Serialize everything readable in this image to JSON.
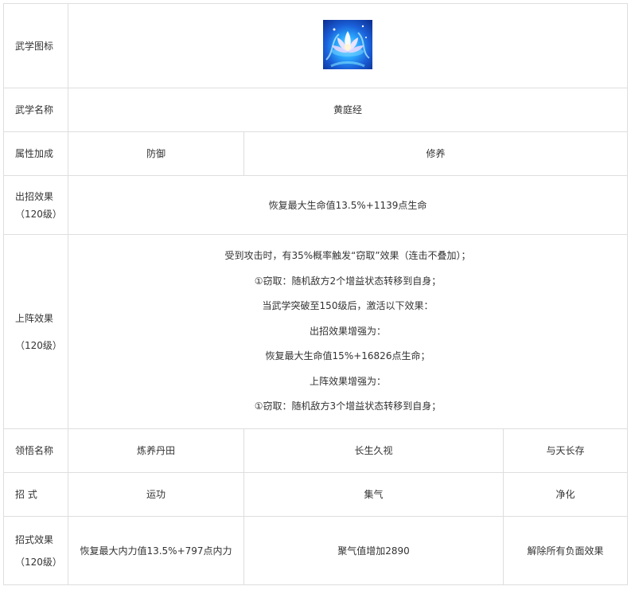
{
  "rows": {
    "icon": {
      "label": "武学图标",
      "icon_name": "lotus-skill-icon"
    },
    "name": {
      "label": "武学名称",
      "value": "黄庭经"
    },
    "attr": {
      "label": "属性加成",
      "values": [
        "防御",
        "修养"
      ]
    },
    "move_effect": {
      "label_lines": [
        "出招效果",
        "（120级）"
      ],
      "value": "恢复最大生命值13.5%+1139点生命"
    },
    "deploy_effect": {
      "label_lines": [
        "上阵效果",
        "（120级）"
      ],
      "lines": [
        "受到攻击时，有35%概率触发“窃取”效果（连击不叠加）；",
        "①窃取：随机敌方2个增益状态转移到自身；",
        "当武学突破至150级后，激活以下效果：",
        "出招效果增强为：",
        "恢复最大生命值15%+16826点生命；",
        "上阵效果增强为：",
        "①窃取：随机敌方3个增益状态转移到自身；"
      ]
    },
    "insight": {
      "label": "领悟名称",
      "values": [
        "炼养丹田",
        "长生久视",
        "与天长存"
      ]
    },
    "moves": {
      "label": "招 式",
      "values": [
        "运功",
        "集气",
        "净化"
      ]
    },
    "move_fx": {
      "label_lines": [
        "招式效果",
        "（120级）"
      ],
      "values": [
        "恢复最大内力值13.5%+797点内力",
        "聚气值增加2890",
        "解除所有负面效果"
      ]
    }
  }
}
